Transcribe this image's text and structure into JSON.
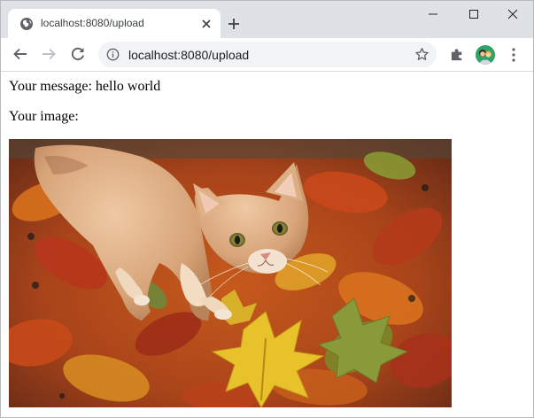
{
  "browser": {
    "tab": {
      "title": "localhost:8080/upload",
      "favicon": "globe-icon"
    },
    "new_tab_icon": "plus-icon",
    "window_controls": [
      "minimize-icon",
      "maximize-icon",
      "close-icon"
    ],
    "toolbar": {
      "back_icon": "arrow-left-icon",
      "forward_icon": "arrow-right-icon",
      "reload_icon": "reload-icon",
      "url": "localhost:8080/upload",
      "site_info_icon": "info-icon",
      "bookmark_icon": "star-icon",
      "extensions_icon": "puzzle-icon",
      "menu_icon": "kebab-menu-icon"
    },
    "colors": {
      "tabstrip_bg": "#dee1e6",
      "omnibox_bg": "#f1f3f4"
    }
  },
  "page": {
    "message_text": "Your message: hello world",
    "image_label": "Your image:",
    "image": {
      "subject": "cat-photo"
    }
  }
}
